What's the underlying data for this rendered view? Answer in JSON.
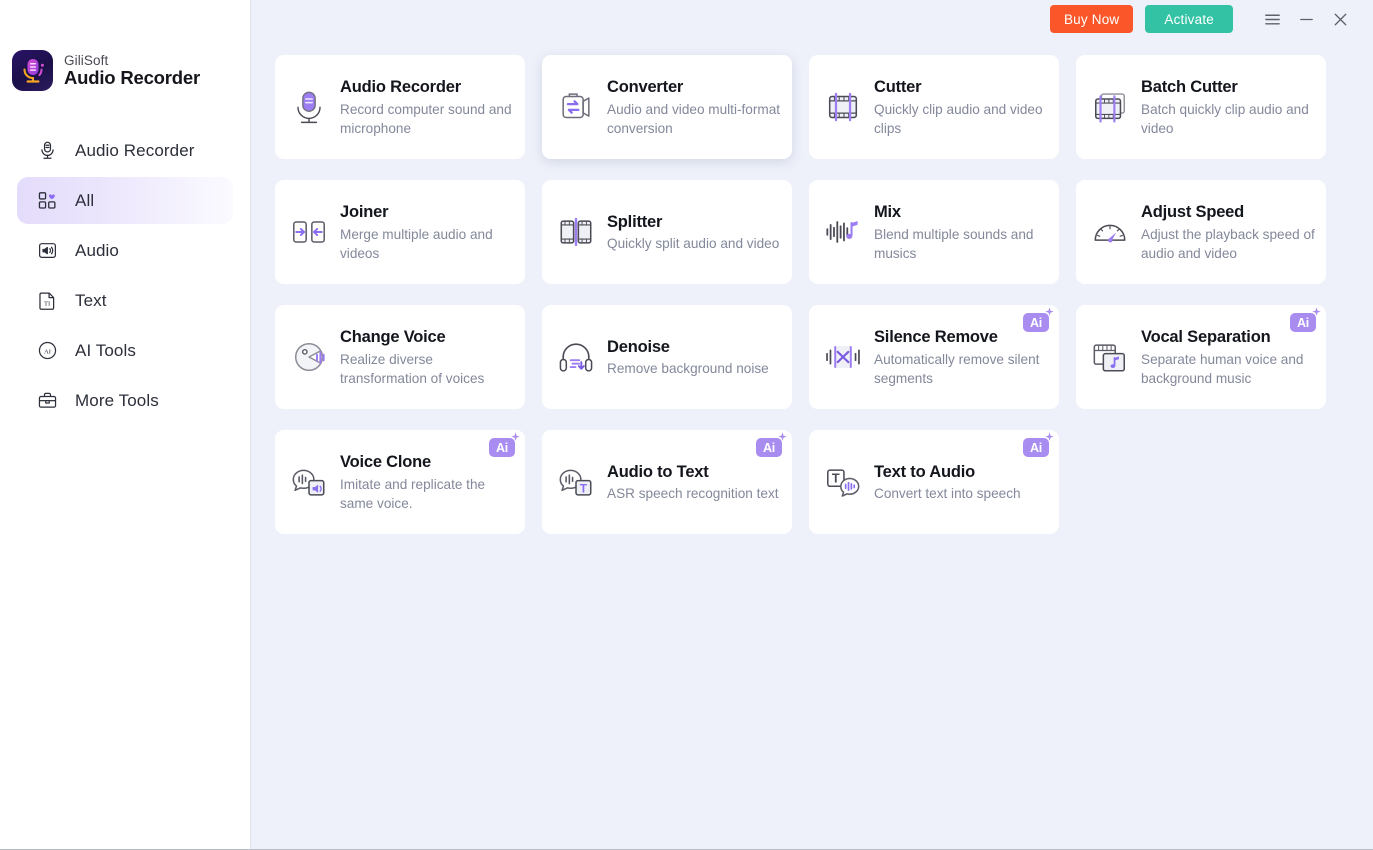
{
  "brand": {
    "company": "GiliSoft",
    "product": "Audio Recorder",
    "logo_icon": "microphone-logo-icon",
    "logo_bg": "#231559"
  },
  "titlebar": {
    "buy_label": "Buy Now",
    "activate_label": "Activate",
    "buy_color": "#fb5629",
    "activate_color": "#33c3a4",
    "menu_icon": "hamburger-menu-icon",
    "minimize_icon": "minimize-icon",
    "close_icon": "close-icon"
  },
  "sidebar": {
    "items": [
      {
        "label": "Audio Recorder",
        "icon": "microphone-icon",
        "active": false
      },
      {
        "label": "All",
        "icon": "grid-heart-icon",
        "active": true
      },
      {
        "label": "Audio",
        "icon": "speaker-icon",
        "active": false
      },
      {
        "label": "Text",
        "icon": "text-file-icon",
        "active": false
      },
      {
        "label": "AI Tools",
        "icon": "ai-circle-icon",
        "active": false
      },
      {
        "label": "More Tools",
        "icon": "toolbox-icon",
        "active": false
      }
    ]
  },
  "accent": {
    "purple": "#8b6ef0",
    "light_purple": "#a88cf0",
    "card_bg": "#ffffff",
    "page_bg": "#eef1f9"
  },
  "cards": [
    {
      "title": "Audio Recorder",
      "desc": "Record computer sound and microphone",
      "icon": "microphone-icon",
      "ai": false,
      "hovered": false
    },
    {
      "title": "Converter",
      "desc": "Audio and video multi-format conversion",
      "icon": "convert-arrows-icon",
      "ai": false,
      "hovered": true
    },
    {
      "title": "Cutter",
      "desc": "Quickly clip audio and video clips",
      "icon": "film-cut-icon",
      "ai": false,
      "hovered": false
    },
    {
      "title": "Batch Cutter",
      "desc": "Batch quickly clip audio and video",
      "icon": "film-batch-cut-icon",
      "ai": false,
      "hovered": false
    },
    {
      "title": "Joiner",
      "desc": "Merge multiple audio and videos",
      "icon": "join-arrows-icon",
      "ai": false,
      "hovered": false
    },
    {
      "title": "Splitter",
      "desc": "Quickly split audio and video",
      "icon": "split-panels-icon",
      "ai": false,
      "hovered": false
    },
    {
      "title": "Mix",
      "desc": "Blend multiple sounds and musics",
      "icon": "waveform-note-icon",
      "ai": false,
      "hovered": false
    },
    {
      "title": "Adjust Speed",
      "desc": "Adjust the playback speed of audio and video",
      "icon": "speedometer-icon",
      "ai": false,
      "hovered": false
    },
    {
      "title": "Change Voice",
      "desc": "Realize diverse transformation of voices",
      "icon": "voice-change-icon",
      "ai": false,
      "hovered": false
    },
    {
      "title": "Denoise",
      "desc": "Remove background noise",
      "icon": "headphones-icon",
      "ai": false,
      "hovered": false
    },
    {
      "title": "Silence Remove",
      "desc": "Automatically remove silent segments",
      "icon": "waveform-cross-icon",
      "ai": true,
      "hovered": false
    },
    {
      "title": "Vocal Separation",
      "desc": "Separate human voice and background music",
      "icon": "stacked-cards-note-icon",
      "ai": true,
      "hovered": false
    },
    {
      "title": "Voice Clone",
      "desc": "Imitate and replicate the same voice.",
      "icon": "bubble-speaker-icon",
      "ai": true,
      "hovered": false
    },
    {
      "title": "Audio to Text",
      "desc": "ASR speech recognition text",
      "icon": "bubble-text-icon",
      "ai": true,
      "hovered": false
    },
    {
      "title": "Text to Audio",
      "desc": "Convert text into speech",
      "icon": "text-bubble-wave-icon",
      "ai": true,
      "hovered": false
    }
  ],
  "ai_badge_label": "Ai"
}
